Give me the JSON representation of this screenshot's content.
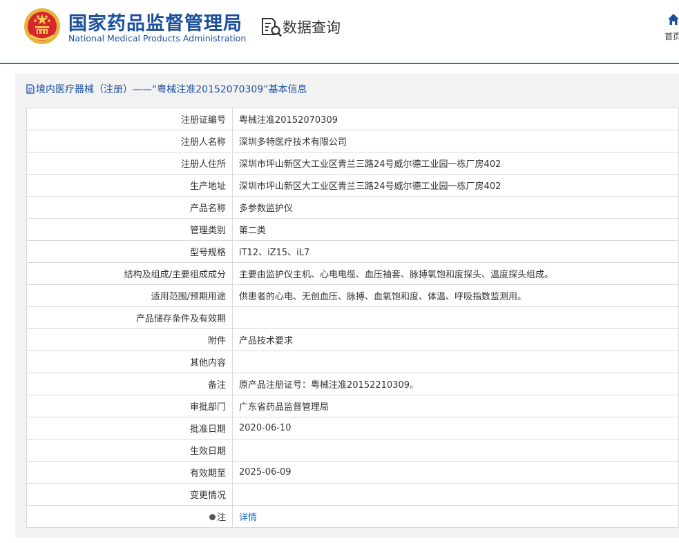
{
  "header": {
    "brand_cn": "国家药品监督管理局",
    "brand_en": "National Medical Products Administration",
    "query_title": "数据查询",
    "home_label": "首页"
  },
  "panel": {
    "title": "境内医疗器械（注册）——“粤械注准20152070309”基本信息"
  },
  "rows": [
    {
      "label": "注册证编号",
      "value": "粤械注准20152070309"
    },
    {
      "label": "注册人名称",
      "value": "深圳多特医疗技术有限公司"
    },
    {
      "label": "注册人住所",
      "value": "深圳市坪山新区大工业区青兰三路24号威尔德工业园一栋厂房402"
    },
    {
      "label": "生产地址",
      "value": "深圳市坪山新区大工业区青兰三路24号威尔德工业园一栋厂房402"
    },
    {
      "label": "产品名称",
      "value": "多参数监护仪"
    },
    {
      "label": "管理类别",
      "value": "第二类"
    },
    {
      "label": "型号规格",
      "value": "iT12、iZ15、iL7"
    },
    {
      "label": "结构及组成/主要组成成分",
      "value": "主要由监护仪主机、心电电缆、血压袖套、脉搏氧饱和度探头、温度探头组成。"
    },
    {
      "label": "适用范围/预期用途",
      "value": "供患者的心电、无创血压、脉搏、血氧饱和度、体温、呼吸指数监测用。"
    },
    {
      "label": "产品储存条件及有效期",
      "value": ""
    },
    {
      "label": "附件",
      "value": "产品技术要求"
    },
    {
      "label": "其他内容",
      "value": ""
    },
    {
      "label": "备注",
      "value": "原产品注册证号：粤械注准20152210309。"
    },
    {
      "label": "审批部门",
      "value": "广东省药品监督管理局"
    },
    {
      "label": "批准日期",
      "value": "2020-06-10"
    },
    {
      "label": "生效日期",
      "value": ""
    },
    {
      "label": "有效期至",
      "value": "2025-06-09"
    },
    {
      "label": "变更情况",
      "value": ""
    },
    {
      "label": "注",
      "value": "详情"
    }
  ],
  "colors": {
    "brand": "#1b4f9c",
    "link": "#1f6fc5",
    "header_line": "#1f6fc5",
    "panel_bg": "#f2f2f2",
    "border": "#d9d9d9"
  },
  "icons": {
    "logo": "national-emblem-icon",
    "query": "document-search-icon",
    "home": "home-icon",
    "title": "document-icon",
    "note": "bulb-icon"
  }
}
